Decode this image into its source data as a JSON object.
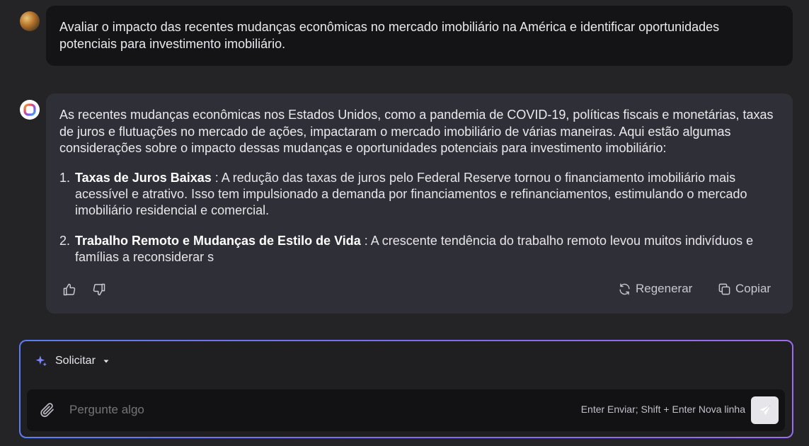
{
  "user_message": {
    "text": "Avaliar o impacto das recentes mudanças econômicas no mercado imobiliário na América e identificar oportunidades potenciais para investimento imobiliário."
  },
  "assistant_message": {
    "intro": "As recentes mudanças econômicas nos Estados Unidos, como a pandemia de COVID-19, políticas fiscais e monetárias, taxas de juros e flutuações no mercado de ações, impactaram o mercado imobiliário de várias maneiras. Aqui estão algumas considerações sobre o impacto dessas mudanças e oportunidades potenciais para investimento imobiliário:",
    "items": [
      {
        "num": "1.",
        "title": "Taxas de Juros Baixas",
        "text": " : A redução das taxas de juros pelo Federal Reserve tornou o financiamento imobiliário mais acessível e atrativo. Isso tem impulsionado a demanda por financiamentos e refinanciamentos, estimulando o mercado imobiliário residencial e comercial."
      },
      {
        "num": "2.",
        "title": "Trabalho Remoto e Mudanças de Estilo de Vida",
        "text": " : A crescente tendência do trabalho remoto levou muitos indivíduos e famílias a reconsiderar s"
      }
    ],
    "actions": {
      "regenerate": "Regenerar",
      "copy": "Copiar"
    }
  },
  "composer": {
    "mode_label": "Solicitar",
    "placeholder": "Pergunte algo",
    "hint": "Enter Enviar; Shift + Enter Nova linha"
  },
  "colors": {
    "accent_start": "#5b7cf5",
    "accent_end": "#9a6cf0",
    "bot_bubble": "#2f2f37",
    "user_bubble": "#141416"
  }
}
